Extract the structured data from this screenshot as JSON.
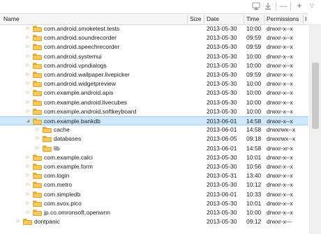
{
  "toolbar": {
    "icons": [
      "device-screen-icon",
      "pull-file-icon",
      "delete-icon",
      "add-folder-icon",
      "view-menu-icon"
    ],
    "glyph_delete": "—",
    "glyph_add": "+",
    "glyph_menu": "▽"
  },
  "columns": {
    "name": "Name",
    "size": "Size",
    "date": "Date",
    "time": "Time",
    "permissions": "Permissions",
    "info": "I"
  },
  "rows": [
    {
      "name": "com.android.smoketest.tests",
      "size": "",
      "date": "2013-05-30",
      "time": "10:00",
      "permissions": "drwxr-x--x",
      "expanded": false,
      "level": 1
    },
    {
      "name": "com.android.soundrecorder",
      "size": "",
      "date": "2013-05-30",
      "time": "09:59",
      "permissions": "drwxr-x--x",
      "expanded": false,
      "level": 1
    },
    {
      "name": "com.android.speechrecorder",
      "size": "",
      "date": "2013-05-30",
      "time": "09:59",
      "permissions": "drwxr-x--x",
      "expanded": false,
      "level": 1
    },
    {
      "name": "com.android.systemui",
      "size": "",
      "date": "2013-05-30",
      "time": "10:00",
      "permissions": "drwxr-x--x",
      "expanded": false,
      "level": 1
    },
    {
      "name": "com.android.vpndialogs",
      "size": "",
      "date": "2013-05-30",
      "time": "10:00",
      "permissions": "drwxr-x--x",
      "expanded": false,
      "level": 1
    },
    {
      "name": "com.android.wallpaper.livepicker",
      "size": "",
      "date": "2013-05-30",
      "time": "09:59",
      "permissions": "drwxr-x--x",
      "expanded": false,
      "level": 1
    },
    {
      "name": "com.android.widgetpreview",
      "size": "",
      "date": "2013-05-30",
      "time": "10:00",
      "permissions": "drwxr-x--x",
      "expanded": false,
      "level": 1
    },
    {
      "name": "com.example.android.apis",
      "size": "",
      "date": "2013-05-30",
      "time": "10:00",
      "permissions": "drwxr-x--x",
      "expanded": false,
      "level": 1
    },
    {
      "name": "com.example.android.livecubes",
      "size": "",
      "date": "2013-05-30",
      "time": "10:00",
      "permissions": "drwxr-x--x",
      "expanded": false,
      "level": 1
    },
    {
      "name": "com.example.android.softkeyboard",
      "size": "",
      "date": "2013-05-30",
      "time": "10:00",
      "permissions": "drwxr-x--x",
      "expanded": false,
      "level": 1
    },
    {
      "name": "com.example.bankdb",
      "size": "",
      "date": "2013-06-01",
      "time": "14:58",
      "permissions": "drwxr-x--x",
      "expanded": true,
      "selected": true,
      "level": 1
    },
    {
      "name": "cache",
      "size": "",
      "date": "2013-06-01",
      "time": "14:58",
      "permissions": "drwxrwx--x",
      "expanded": false,
      "level": 2
    },
    {
      "name": "databases",
      "size": "",
      "date": "2013-06-05",
      "time": "09:18",
      "permissions": "drwxrwx--x",
      "expanded": false,
      "level": 2
    },
    {
      "name": "lib",
      "size": "",
      "date": "2013-06-01",
      "time": "14:58",
      "permissions": "drwxr-xr-x",
      "expanded": false,
      "level": 2
    },
    {
      "name": "com.example.calci",
      "size": "",
      "date": "2013-05-30",
      "time": "10:01",
      "permissions": "drwxr-x--x",
      "expanded": false,
      "level": 1
    },
    {
      "name": "com.example.form",
      "size": "",
      "date": "2013-05-30",
      "time": "10:56",
      "permissions": "drwxr-x--x",
      "expanded": false,
      "level": 1
    },
    {
      "name": "com.login",
      "size": "",
      "date": "2013-05-31",
      "time": "13:40",
      "permissions": "drwxr-x--x",
      "expanded": false,
      "level": 1
    },
    {
      "name": "com.metro",
      "size": "",
      "date": "2013-05-30",
      "time": "10:12",
      "permissions": "drwxr-x--x",
      "expanded": false,
      "level": 1
    },
    {
      "name": "com.simpledb",
      "size": "",
      "date": "2013-06-01",
      "time": "10:33",
      "permissions": "drwxr-x--x",
      "expanded": false,
      "level": 1
    },
    {
      "name": "com.svox.pico",
      "size": "",
      "date": "2013-05-30",
      "time": "10:01",
      "permissions": "drwxr-x--x",
      "expanded": false,
      "level": 1
    },
    {
      "name": "jp.co.omronsoft.openwnn",
      "size": "",
      "date": "2013-05-30",
      "time": "10:00",
      "permissions": "drwxr-x--x",
      "expanded": false,
      "level": 1
    },
    {
      "name": "dontpanic",
      "size": "",
      "date": "2013-05-30",
      "time": "09:12",
      "permissions": "drwxr-x---",
      "expanded": false,
      "level": 0
    }
  ],
  "colors": {
    "selection": "#cfe8fc",
    "folder": "#f5c860"
  }
}
